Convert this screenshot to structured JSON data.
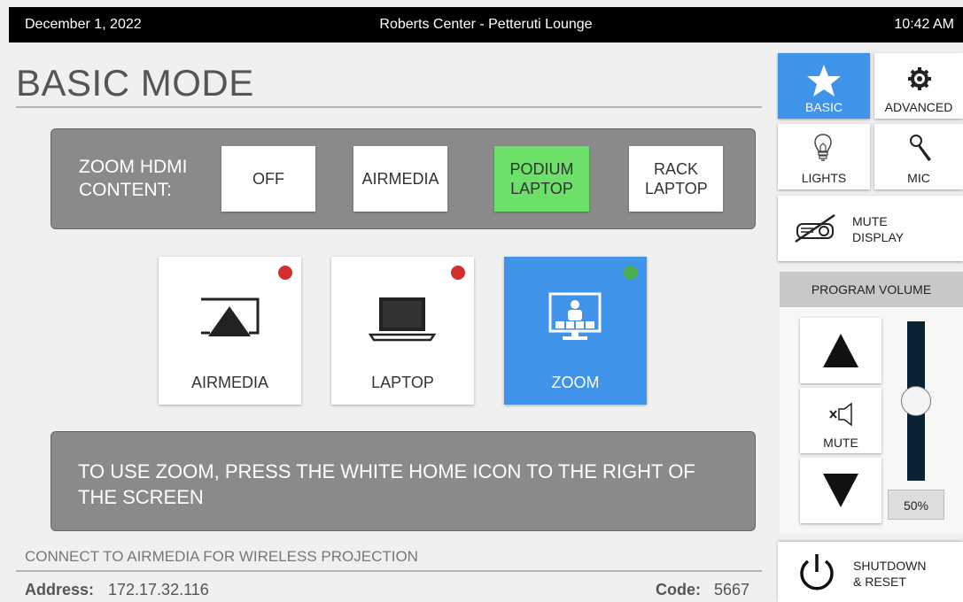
{
  "header": {
    "date": "December 1, 2022",
    "room": "Roberts Center - Petteruti Lounge",
    "time": "10:42 AM"
  },
  "page_title": "BASIC MODE",
  "hdmi": {
    "label": "ZOOM HDMI CONTENT:",
    "buttons": [
      {
        "label": "OFF",
        "active": false
      },
      {
        "label": "AIRMEDIA",
        "active": false
      },
      {
        "label": "PODIUM LAPTOP",
        "active": true
      },
      {
        "label": "RACK LAPTOP",
        "active": false
      }
    ],
    "active_color": "#6ce069"
  },
  "sources": [
    {
      "label": "AIRMEDIA",
      "icon": "airplay-icon",
      "status": "red",
      "active": false
    },
    {
      "label": "LAPTOP",
      "icon": "laptop-icon",
      "status": "red",
      "active": false
    },
    {
      "label": "ZOOM",
      "icon": "zoom-room-icon",
      "status": "green",
      "active": true
    }
  ],
  "status_colors": {
    "red": "#d32f2f",
    "green": "#4caf50"
  },
  "message": "TO USE ZOOM, PRESS THE WHITE HOME ICON TO THE RIGHT OF THE SCREEN",
  "airmedia_note": "CONNECT TO AIRMEDIA FOR WIRELESS PROJECTION",
  "address": {
    "label": "Address:",
    "value": "172.17.32.116"
  },
  "code": {
    "label": "Code:",
    "value": "5667"
  },
  "sidebar": {
    "basic": {
      "label": "BASIC",
      "icon": "star-icon",
      "active": true
    },
    "advanced": {
      "label": "ADVANCED",
      "icon": "gear-icon"
    },
    "lights": {
      "label": "LIGHTS",
      "icon": "lightbulb-icon"
    },
    "mic": {
      "label": "MIC",
      "icon": "microphone-icon"
    },
    "mute_display": {
      "label_line1": "MUTE",
      "label_line2": "DISPLAY",
      "icon": "projector-muted-icon"
    },
    "volume": {
      "header": "PROGRAM VOLUME",
      "mute_label": "MUTE",
      "level_text": "50%",
      "level": 0.5
    },
    "shutdown": {
      "label_line1": "SHUTDOWN",
      "label_line2": "& RESET",
      "icon": "power-icon"
    }
  },
  "accent_color": "#3f93e9"
}
